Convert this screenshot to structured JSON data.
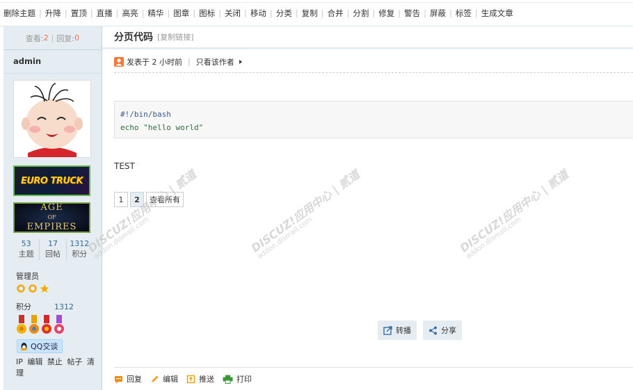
{
  "modbar": {
    "items": [
      "删除主题",
      "升降",
      "置顶",
      "直播",
      "高亮",
      "精华",
      "图章",
      "图标",
      "关闭",
      "移动",
      "分类",
      "复制",
      "合并",
      "分割",
      "修复",
      "警告",
      "屏蔽",
      "标签",
      "生成文章"
    ]
  },
  "sidebar": {
    "views_label": "查看:",
    "views": "2",
    "replies_label": "回复:",
    "replies": "0",
    "author": "admin",
    "medal_euro": "EURO TRUCK",
    "medal_age_line1": "AGE",
    "medal_age_line2": "OF",
    "medal_age_line3": "EMPIRES",
    "counts": [
      {
        "num": "53",
        "label": "主题"
      },
      {
        "num": "17",
        "label": "回帖"
      },
      {
        "num": "1312",
        "label": "积分"
      }
    ],
    "group": "管理员",
    "score_label": "积分",
    "score_value": "1312",
    "qq_label": "QQ交谈",
    "links": [
      "IP",
      "编辑",
      "禁止",
      "帖子",
      "清理"
    ]
  },
  "post": {
    "title": "分页代码",
    "copy_link": "[复制链接]",
    "posted": "发表于 2 小时前",
    "only_author": "只看该作者",
    "code_line1": "#!/bin/bash",
    "code_line2": "echo \"hello world\"",
    "body": "TEST",
    "pages": [
      "1",
      "2"
    ],
    "view_all": "查看所有",
    "current_page": "2"
  },
  "actions": {
    "forward": "转播",
    "share": "分享",
    "reply": "回复",
    "edit": "编辑",
    "push": "推送",
    "print": "打印"
  },
  "watermark": {
    "main": "DISCUZ!应用中心 | 贰道",
    "sub": "addon.dismall.com"
  },
  "colors": {
    "accent": "#369",
    "highlight": "#f26c4f",
    "sidebar_bg": "#e5edf2"
  }
}
